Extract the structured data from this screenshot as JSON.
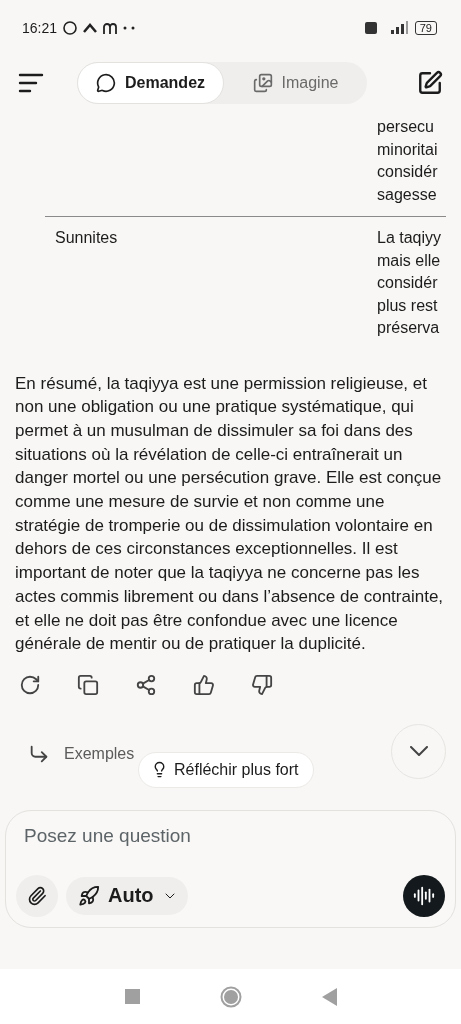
{
  "status_bar": {
    "time": "16:21",
    "battery": "79"
  },
  "header": {
    "tabs": [
      {
        "label": "Demandez",
        "selected": true
      },
      {
        "label": "Imagine",
        "selected": false
      }
    ]
  },
  "table": {
    "rows": [
      {
        "column_1": "",
        "column_2": [
          "persecu",
          "minoritai",
          "considér",
          "sagesse"
        ]
      },
      {
        "column_1": "Sunnites",
        "column_2": [
          "La taqiyy",
          "mais elle",
          "considér",
          "plus rest",
          "préserva"
        ]
      }
    ]
  },
  "summary": "En résumé, la taqiyya est une permission religieuse, et non une obligation ou une pratique systématique, qui permet à un musulman de dissimuler sa foi dans des situations où la révélation de celle-ci entraînerait un danger mortel ou une persécution grave. Elle est conçue comme une mesure de survie et non comme une stratégie de tromperie ou de dissimulation volontaire en dehors de ces circonstances exceptionnelles. Il est important de noter que la taqiyya ne concerne pas les actes commis librement ou dans l’absence de contrainte, et elle ne doit pas être confondue avec une licence générale de mentir ou de pratiquer la duplicité.",
  "actions": [
    {
      "kind": "regenerate"
    },
    {
      "kind": "copy"
    },
    {
      "kind": "share"
    },
    {
      "kind": "like"
    },
    {
      "kind": "dislike"
    }
  ],
  "follow_up": "Exemples",
  "think_chip": "Réfléchir plus fort",
  "composer": {
    "placeholder": "Posez une question",
    "mode": "Auto"
  }
}
